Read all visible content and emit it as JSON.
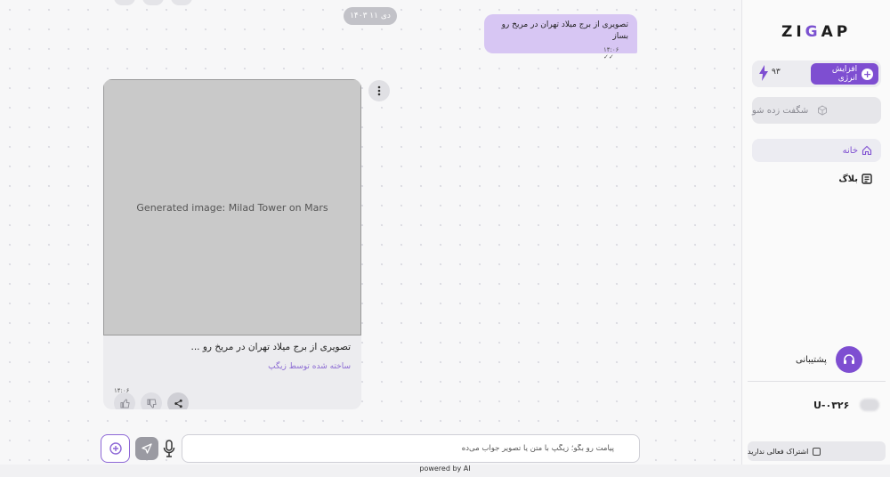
{
  "chat": {
    "date_label": "۱۴۰۳ دی ۱۱",
    "user_message": {
      "text": "تصویری از برج میلاد تهران در مریخ رو بساز",
      "time": "۱۴:۰۶",
      "status_icon": "double-check-icon"
    },
    "bot_message": {
      "image_alt": "Generated image: Milad Tower on Mars",
      "caption": "تصویری از برج میلاد تهران در مریخ رو ...",
      "credit": "ساخته شده توسط زیگپ",
      "time": "۱۴:۰۶",
      "actions": [
        "thumbs-up-icon",
        "thumbs-down-icon",
        "share-icon"
      ]
    }
  },
  "composer": {
    "placeholder": "پیامت رو بگو؛ زیگپ با متن یا تصویر جواب می‌ده"
  },
  "footer": {
    "powered_by": "powered by AI"
  },
  "sidebar": {
    "logo": {
      "left": "ZI",
      "mid": "G",
      "right": "AP"
    },
    "energy": {
      "value": "۹۳",
      "button_label": "افزایش انرژی"
    },
    "surprise_label": "شگفت زده شو",
    "nav": [
      {
        "label": "خانه",
        "icon": "home-icon",
        "active": true
      },
      {
        "label": "بلاگ",
        "icon": "blog-icon",
        "active": false
      }
    ],
    "support_label": "پشتیبانی",
    "user_code": "U-۰۳۲۶",
    "subscription_label": "اشتراک فعالی ندارید"
  },
  "colors": {
    "accent": "#7e4ed1",
    "user_bubble": "#d7c6f3"
  }
}
